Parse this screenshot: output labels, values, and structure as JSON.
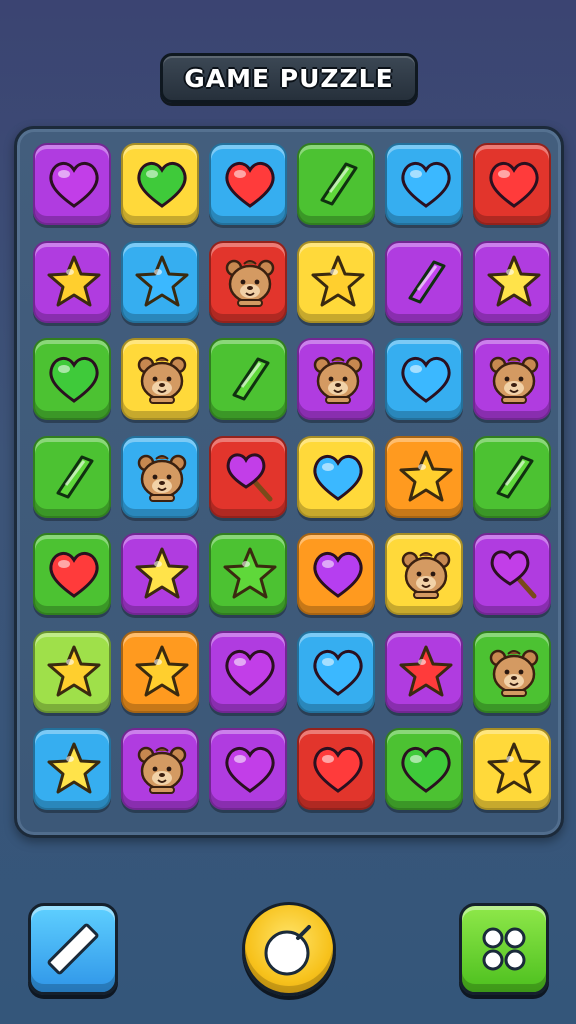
{
  "header": {
    "title": "GAME PUZZLE"
  },
  "board": {
    "rows": [
      [
        {
          "color": "purple",
          "icon": "heart-icon"
        },
        {
          "color": "yellow",
          "icon": "heart-icon"
        },
        {
          "color": "blue",
          "icon": "heart-icon"
        },
        {
          "color": "green",
          "icon": "gem-icon"
        },
        {
          "color": "blue",
          "icon": "heart-icon"
        },
        {
          "color": "red",
          "icon": "heart-icon"
        }
      ],
      [
        {
          "color": "purple",
          "icon": "star-icon"
        },
        {
          "color": "blue",
          "icon": "star-icon"
        },
        {
          "color": "red",
          "icon": "bear-icon"
        },
        {
          "color": "yellow",
          "icon": "star-icon"
        },
        {
          "color": "purple",
          "icon": "gem-icon"
        },
        {
          "color": "purple",
          "icon": "star-icon"
        }
      ],
      [
        {
          "color": "green",
          "icon": "heart-icon"
        },
        {
          "color": "yellow",
          "icon": "bear-icon"
        },
        {
          "color": "green",
          "icon": "gem-icon"
        },
        {
          "color": "purple",
          "icon": "bear-icon"
        },
        {
          "color": "blue",
          "icon": "heart-icon"
        },
        {
          "color": "purple",
          "icon": "bear-icon"
        }
      ],
      [
        {
          "color": "green",
          "icon": "gem-icon"
        },
        {
          "color": "blue",
          "icon": "bear-icon"
        },
        {
          "color": "red",
          "icon": "lollipop-icon"
        },
        {
          "color": "yellow",
          "icon": "heart-icon"
        },
        {
          "color": "orange",
          "icon": "star-icon"
        },
        {
          "color": "green",
          "icon": "gem-icon"
        }
      ],
      [
        {
          "color": "green",
          "icon": "heart-icon"
        },
        {
          "color": "purple",
          "icon": "star-icon"
        },
        {
          "color": "green",
          "icon": "star-icon"
        },
        {
          "color": "orange",
          "icon": "heart-icon"
        },
        {
          "color": "yellow",
          "icon": "bear-icon"
        },
        {
          "color": "purple",
          "icon": "lollipop-icon"
        }
      ],
      [
        {
          "color": "lime",
          "icon": "star-icon"
        },
        {
          "color": "orange",
          "icon": "star-icon"
        },
        {
          "color": "purple",
          "icon": "heart-icon"
        },
        {
          "color": "blue",
          "icon": "heart-icon"
        },
        {
          "color": "purple",
          "icon": "star-icon"
        },
        {
          "color": "green",
          "icon": "bear-icon"
        }
      ],
      [
        {
          "color": "blue",
          "icon": "star-icon"
        },
        {
          "color": "purple",
          "icon": "bear-icon"
        },
        {
          "color": "purple",
          "icon": "heart-icon"
        },
        {
          "color": "red",
          "icon": "heart-icon"
        },
        {
          "color": "green",
          "icon": "heart-icon"
        },
        {
          "color": "yellow",
          "icon": "star-icon"
        }
      ]
    ]
  },
  "toolbar": {
    "left_icon": "pencil-icon",
    "center_icon": "hint-icon",
    "right_icon": "menu-dots-icon"
  },
  "colors": {
    "purple": "#b03ce0",
    "yellow": "#ffd93a",
    "blue": "#36aef0",
    "green": "#4cc232",
    "red": "#e2352c",
    "orange": "#ff9a1f",
    "lime": "#9fe04a"
  }
}
